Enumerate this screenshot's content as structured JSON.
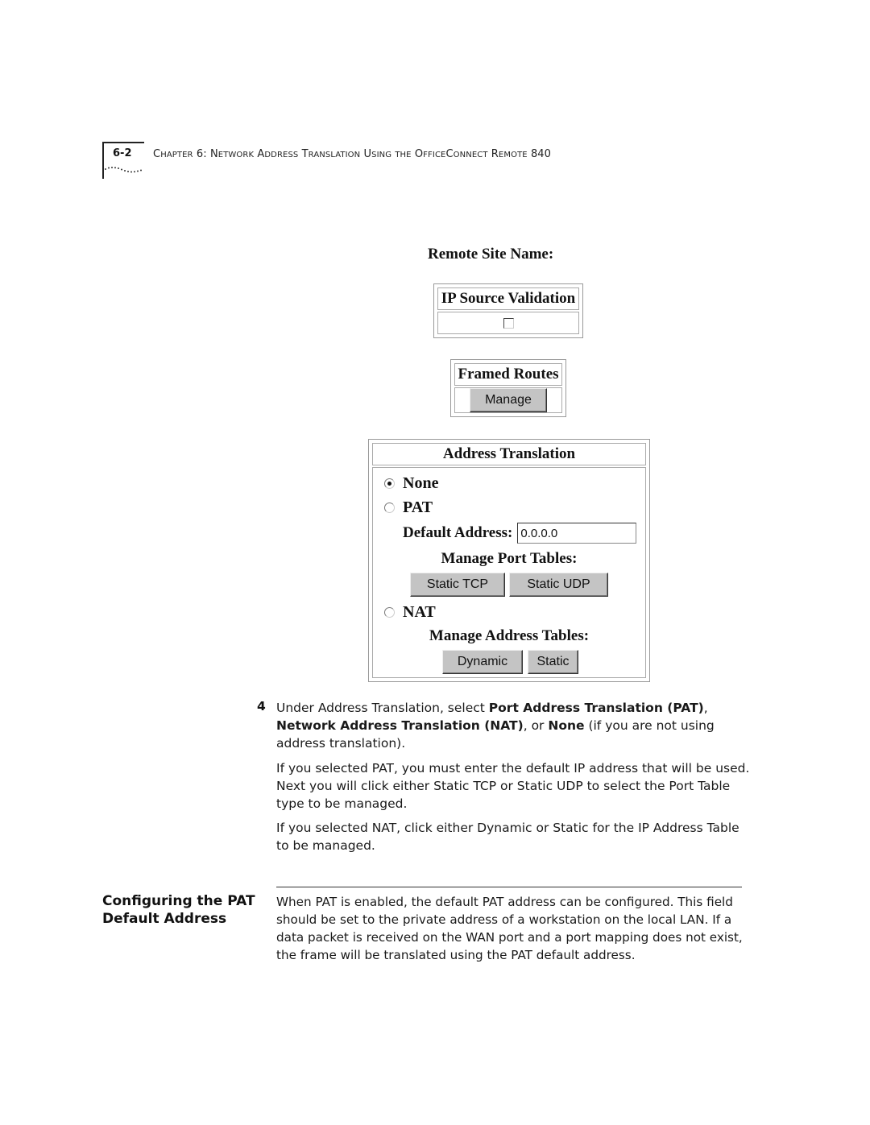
{
  "header": {
    "page_number": "6-2",
    "running_head": "Chapter 6: Network Address Translation Using the OfficeConnect Remote 840"
  },
  "web_ui": {
    "remote_site_name_label": "Remote Site Name:",
    "ip_source_validation": {
      "title": "IP Source Validation",
      "checked": false
    },
    "framed_routes": {
      "title": "Framed Routes",
      "manage_button": "Manage"
    },
    "address_translation": {
      "title": "Address Translation",
      "options": [
        {
          "label": "None",
          "selected": true
        },
        {
          "label": "PAT",
          "selected": false
        },
        {
          "label": "NAT",
          "selected": false
        }
      ],
      "default_address_label": "Default Address:",
      "default_address_value": "0.0.0.0",
      "manage_port_tables_label": "Manage Port Tables:",
      "static_tcp_button": "Static TCP",
      "static_udp_button": "Static UDP",
      "manage_address_tables_label": "Manage Address Tables:",
      "dynamic_button": "Dynamic",
      "static_button": "Static"
    }
  },
  "body": {
    "step_number": "4",
    "step_parts": [
      {
        "text": "Under Address Translation, select ",
        "bold": false
      },
      {
        "text": "Port Address Translation (PAT)",
        "bold": true
      },
      {
        "text": ", ",
        "bold": false
      },
      {
        "text": "Network Address Translation (NAT)",
        "bold": true
      },
      {
        "text": ", or ",
        "bold": false
      },
      {
        "text": "None",
        "bold": true
      },
      {
        "text": " (if you are not using address translation).",
        "bold": false
      }
    ],
    "para_pat": "If you selected PAT, you must enter the default IP address that will be used. Next you will click either Static TCP or Static UDP to select the Port Table type to be managed.",
    "para_nat": "If you selected NAT, click either Dynamic or Static for the IP Address Table to be managed.",
    "section_heading_line1": "Configuring the PAT",
    "section_heading_line2": "Default Address",
    "section_text": "When PAT is enabled, the default PAT address can be configured. This field should be set to the private address of a workstation on the local LAN. If a data packet is received on the WAN port and a port mapping does not exist, the frame will be translated using the PAT default address."
  }
}
